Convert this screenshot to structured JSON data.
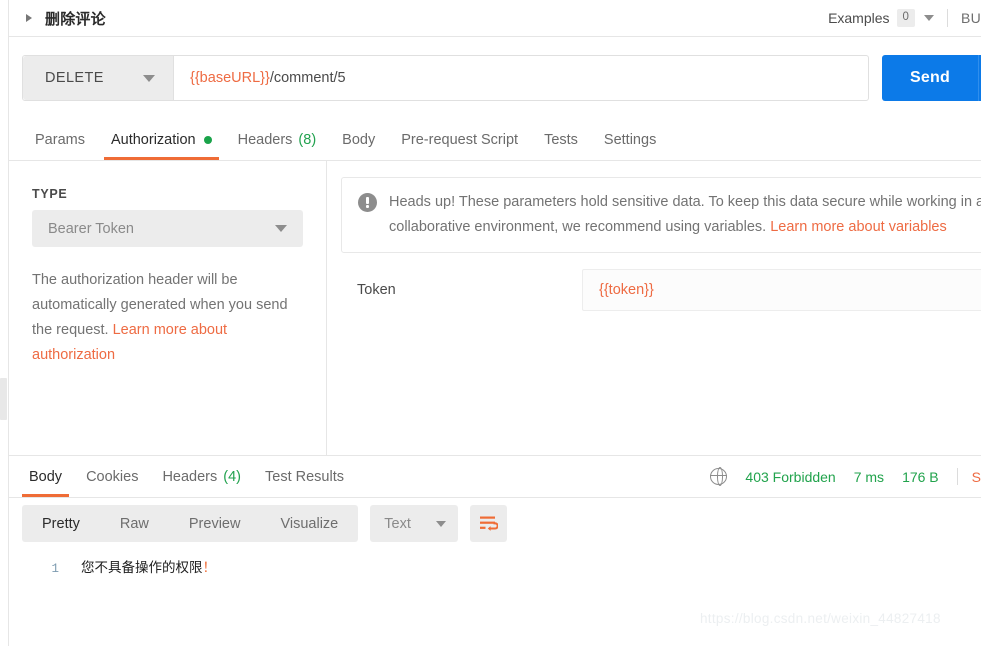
{
  "request": {
    "name": "删除评论",
    "examples_label": "Examples",
    "examples_count": "0",
    "build_label": "BU",
    "method": "DELETE",
    "url_variable": "{{baseURL}}",
    "url_path": "/comment/5",
    "send_label": "Send"
  },
  "request_tabs": [
    {
      "label": "Params"
    },
    {
      "label": "Authorization"
    },
    {
      "label": "Headers",
      "count": "(8)"
    },
    {
      "label": "Body"
    },
    {
      "label": "Pre-request Script"
    },
    {
      "label": "Tests"
    },
    {
      "label": "Settings"
    }
  ],
  "auth": {
    "type_label": "TYPE",
    "type_value": "Bearer Token",
    "help_text": "The authorization header will be automatically generated when you send the request. ",
    "help_link": "Learn more about authorization",
    "warning_text": "Heads up! These parameters hold sensitive data. To keep this data secure while working in a collaborative environment, we recommend using variables. ",
    "warning_link": "Learn more about variables",
    "token_label": "Token",
    "token_value": "{{token}}"
  },
  "response_tabs": [
    {
      "label": "Body"
    },
    {
      "label": "Cookies"
    },
    {
      "label": "Headers",
      "count": "(4)"
    },
    {
      "label": "Test Results"
    }
  ],
  "response_status": {
    "status": "403 Forbidden",
    "time": "7 ms",
    "size": "176 B",
    "save_label": "S"
  },
  "body_toolbar": {
    "views": [
      {
        "label": "Pretty"
      },
      {
        "label": "Raw"
      },
      {
        "label": "Preview"
      },
      {
        "label": "Visualize"
      }
    ],
    "format": "Text"
  },
  "response_body": {
    "line_number": "1",
    "text": "您不具备操作的权限",
    "suffix": "！"
  },
  "watermark": "https://blog.csdn.net/weixin_44827418"
}
